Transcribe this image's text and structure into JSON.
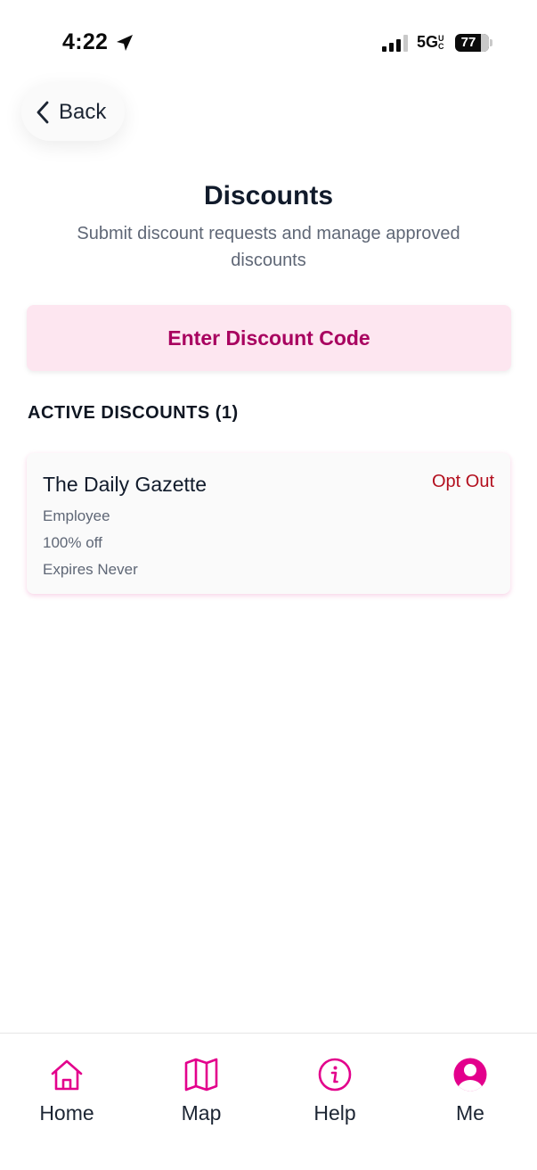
{
  "status_bar": {
    "time": "4:22",
    "network": "5G",
    "network_suffix": "UC",
    "battery": "77",
    "battery_percent": 77
  },
  "header": {
    "back_label": "Back",
    "title": "Discounts",
    "subtitle": "Submit discount requests and manage approved discounts"
  },
  "actions": {
    "enter_code_label": "Enter Discount Code"
  },
  "active_discounts": {
    "heading": "ACTIVE DISCOUNTS (1)",
    "items": [
      {
        "name": "The Daily Gazette",
        "type": "Employee",
        "amount": "100% off",
        "expires": "Expires Never",
        "action_label": "Opt Out"
      }
    ]
  },
  "bottom_nav": {
    "items": [
      {
        "label": "Home",
        "icon": "home-icon"
      },
      {
        "label": "Map",
        "icon": "map-icon"
      },
      {
        "label": "Help",
        "icon": "info-icon"
      },
      {
        "label": "Me",
        "icon": "user-icon"
      }
    ]
  },
  "colors": {
    "accent": "#e3008c",
    "code_button_bg": "#fde6f0",
    "code_button_text": "#a8005f",
    "opt_out": "#b30f1e"
  }
}
